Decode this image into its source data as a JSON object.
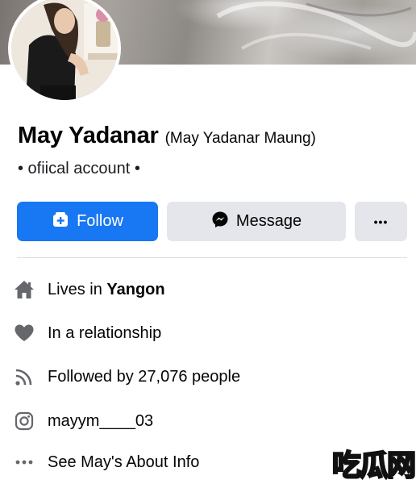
{
  "profile": {
    "name": "May Yadanar",
    "alternate_name": "(May Yadanar Maung)",
    "subtitle": "• ofiical account •"
  },
  "actions": {
    "follow_label": "Follow",
    "message_label": "Message",
    "more_label": "•••"
  },
  "about": {
    "lives_prefix": "Lives in ",
    "lives_city": "Yangon",
    "relationship": "In a relationship",
    "followers": "Followed by 27,076 people",
    "instagram": "mayym____03",
    "see_about": "See May's About Info"
  },
  "watermark": {
    "text": "吃瓜网"
  },
  "colors": {
    "primary": "#1877f2",
    "secondary_button": "#e4e6eb",
    "icon_gray": "#65676b",
    "text": "#050505"
  },
  "icons": {
    "follow": "follow-plus-icon",
    "message": "messenger-icon",
    "home": "home-icon",
    "heart": "heart-icon",
    "rss": "rss-followers-icon",
    "instagram": "instagram-icon",
    "more": "more-dots-icon"
  }
}
